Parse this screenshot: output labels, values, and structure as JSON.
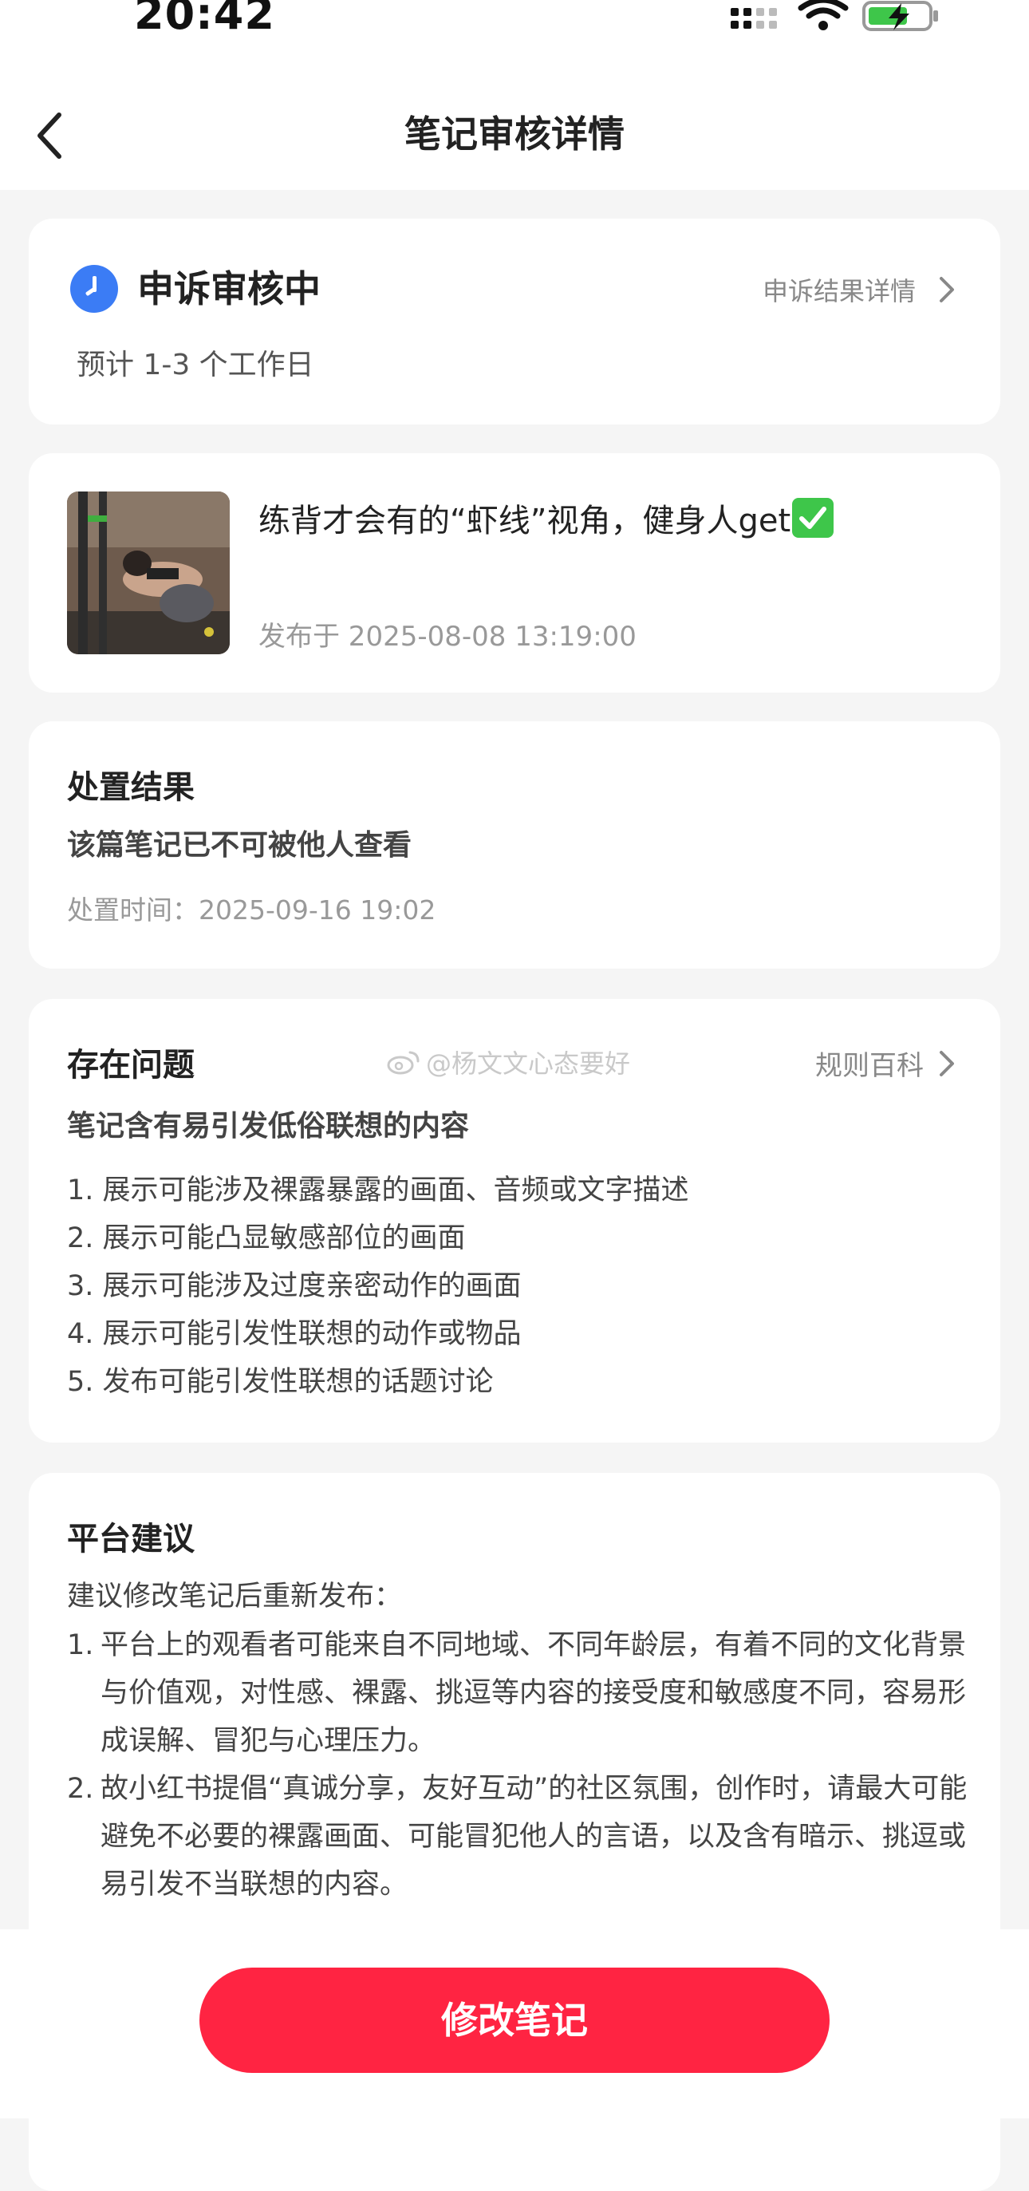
{
  "status_bar": {
    "time": "20:42"
  },
  "nav": {
    "title": "笔记审核详情"
  },
  "status": {
    "title": "申诉审核中",
    "subtitle": "预计 1-3 个工作日",
    "link_label": "申诉结果详情"
  },
  "note": {
    "title": "练背才会有的“虾线”视角，健身人get",
    "published": "发布于 2025-08-08 13:19:00"
  },
  "result": {
    "heading": "处置结果",
    "text": "该篇笔记已不可被他人查看",
    "time": "处置时间：2025-09-16 19:02"
  },
  "problem": {
    "heading": "存在问题",
    "rules_label": "规则百科",
    "watermark": "@杨文文心态要好",
    "subtitle": "笔记含有易引发低俗联想的内容",
    "items": [
      "1.  展示可能涉及裸露暴露的画面、音频或文字描述",
      "2. 展示可能凸显敏感部位的画面",
      "3. 展示可能涉及过度亲密动作的画面",
      "4. 展示可能引发性联想的动作或物品",
      "5. 发布可能引发性联想的话题讨论"
    ]
  },
  "suggestion": {
    "heading": "平台建议",
    "intro": "建议修改笔记后重新发布：",
    "items": [
      {
        "num": "1.",
        "text": "平台上的观看者可能来自不同地域、不同年龄层，有着不同的文化背景与价值观，对性感、裸露、挑逗等内容的接受度和敏感度不同，容易形成误解、冒犯与心理压力。"
      },
      {
        "num": "2.",
        "text": "故小红书提倡“真诚分享，友好互动”的社区氛围，创作时，请最大可能避免不必要的裸露画面、可能冒犯他人的言语，以及含有暗示、挑逗或易引发不当联想的内容。"
      }
    ]
  },
  "action": {
    "edit_label": "修改笔记"
  },
  "colors": {
    "accent": "#ff2442",
    "status_blue": "#3b7cf5",
    "check_green": "#3ec64a"
  },
  "icons": [
    "signal-icon",
    "wifi-icon",
    "battery-charging-icon",
    "back-arrow-icon",
    "clock-icon",
    "chevron-right-icon",
    "check-mark-icon",
    "weibo-icon"
  ]
}
